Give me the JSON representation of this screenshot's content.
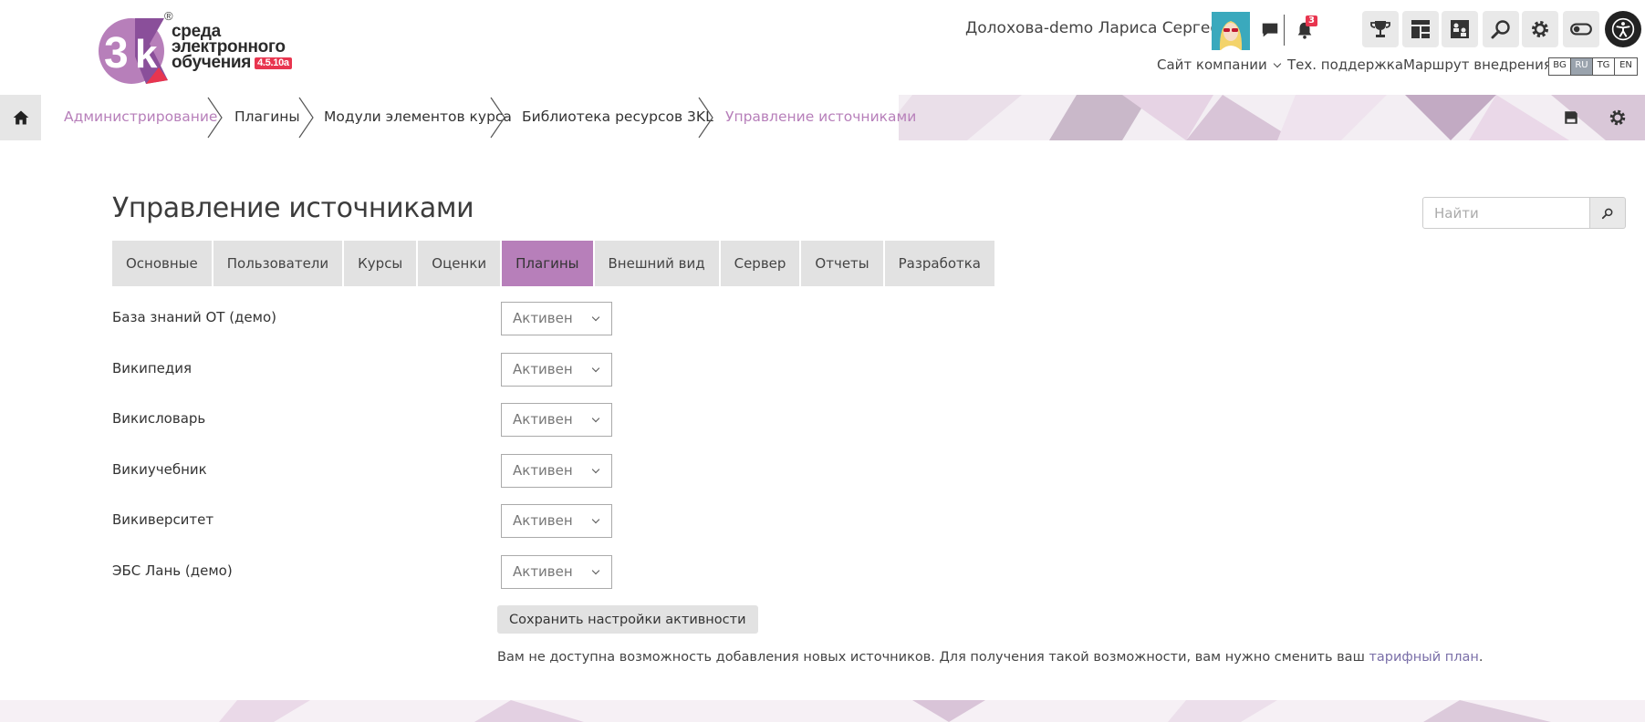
{
  "logo": {
    "line1": "среда",
    "line2": "электронного",
    "line3": "обучения",
    "version": "4.5.10a",
    "registered": "®"
  },
  "user": {
    "name": "Долохова-demo Лариса Сергеевна",
    "notifications_count": "3"
  },
  "top_links": {
    "company": "Сайт компании",
    "support": "Тех. поддержка",
    "route": "Маршрут внедрения"
  },
  "languages": [
    "BG",
    "RU",
    "TG",
    "EN"
  ],
  "active_language": "RU",
  "breadcrumbs": [
    "Администрирование",
    "Плагины",
    "Модули элементов курса",
    "Библиотека ресурсов 3KL",
    "Управление источниками"
  ],
  "page": {
    "title": "Управление источниками"
  },
  "search": {
    "placeholder": "Найти"
  },
  "tabs": [
    "Основные",
    "Пользователи",
    "Курсы",
    "Оценки",
    "Плагины",
    "Внешний вид",
    "Сервер",
    "Отчеты",
    "Разработка"
  ],
  "active_tab": "Плагины",
  "sources": [
    {
      "label": "База знаний ОТ (демо)",
      "status": "Активен"
    },
    {
      "label": "Википедия",
      "status": "Активен"
    },
    {
      "label": "Викисловарь",
      "status": "Активен"
    },
    {
      "label": "Викиучебник",
      "status": "Активен"
    },
    {
      "label": "Викиверситет",
      "status": "Активен"
    },
    {
      "label": "ЭБС Лань (демо)",
      "status": "Активен"
    }
  ],
  "save_button": "Сохранить настройки активности",
  "notice": {
    "text": "Вам не доступна возможность добавления новых источников. Для получения такой возможности, вам нужно сменить ваш ",
    "link": "тарифный план",
    "end": "."
  },
  "colors": {
    "accent": "#b77fba",
    "badge": "#e8354f",
    "tab_bg": "#e2e2e2"
  }
}
